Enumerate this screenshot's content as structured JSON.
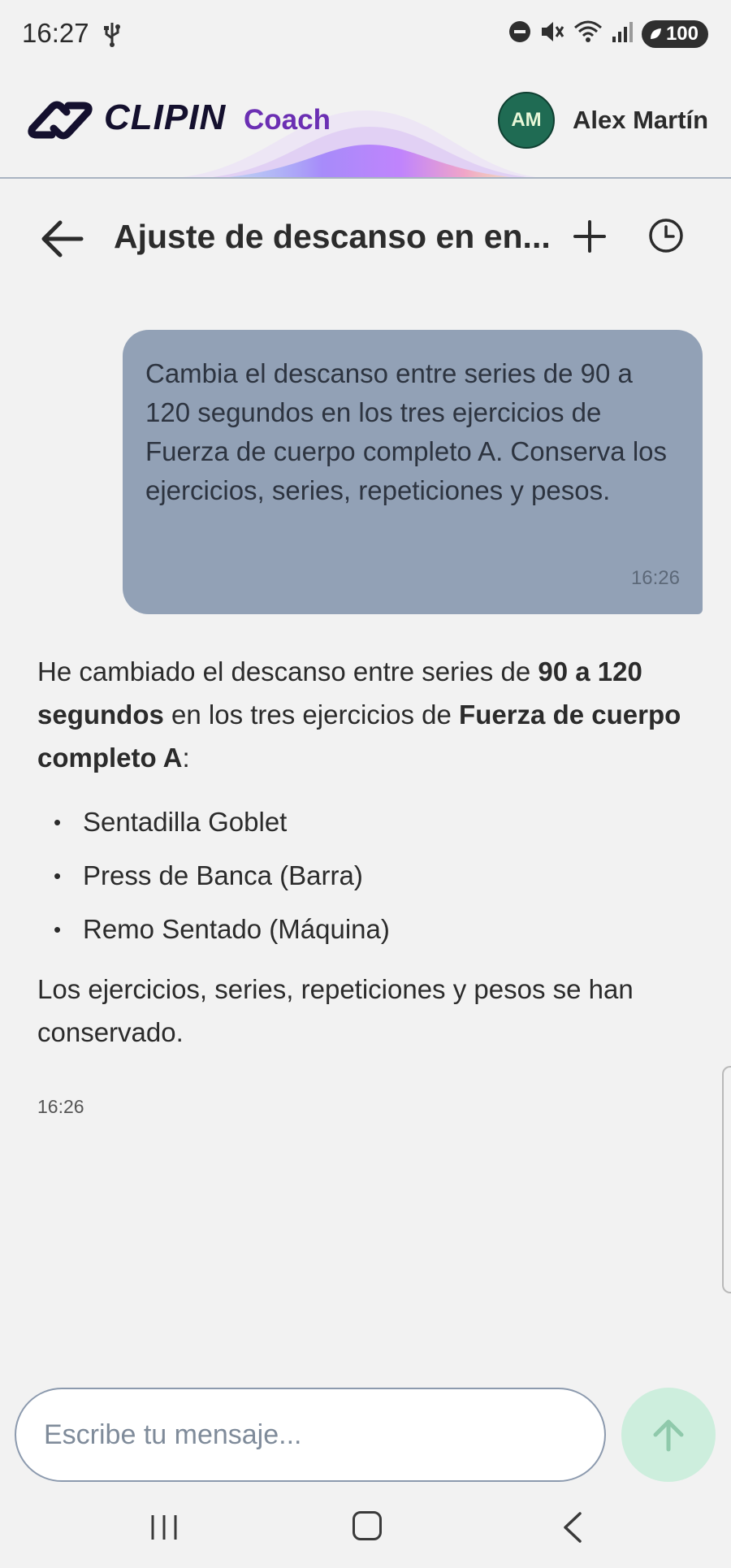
{
  "status_bar": {
    "time": "16:27",
    "battery": "100"
  },
  "app_header": {
    "brand": "CLIPIN",
    "product": "Coach",
    "user": {
      "initials": "AM",
      "name": "Alex Martín"
    }
  },
  "chat": {
    "title": "Ajuste de descanso en en...",
    "messages": {
      "user": {
        "text": "Cambia el descanso entre series de 90 a 120 segundos en los tres ejercicios de Fuerza de cuerpo completo A. Conserva los ejercicios, series, repeticiones y pesos.",
        "time": "16:26"
      },
      "assistant": {
        "intro_1": "He cambiado el descanso entre series de ",
        "intro_bold_1": "90 a 120 segundos",
        "intro_2": " en los tres ejercicios de ",
        "intro_bold_2": "Fuerza de cuerpo completo A",
        "intro_3": ":",
        "items": [
          "Sentadilla Goblet",
          "Press de Banca (Barra)",
          "Remo Sentado (Máquina)"
        ],
        "outro": "Los ejercicios, series, repeticiones y pesos se han conservado.",
        "time": "16:26"
      }
    }
  },
  "composer": {
    "placeholder": "Escribe tu mensaje..."
  },
  "icons": {
    "back": "arrow-left-icon",
    "new": "plus-icon",
    "history": "clock-icon",
    "send": "arrow-up-icon"
  },
  "colors": {
    "brand_dark": "#14102e",
    "brand_purple": "#6b2fb3",
    "user_bubble": "#92a1b6",
    "avatar": "#1f6b53",
    "send_button": "#cdeedd"
  }
}
